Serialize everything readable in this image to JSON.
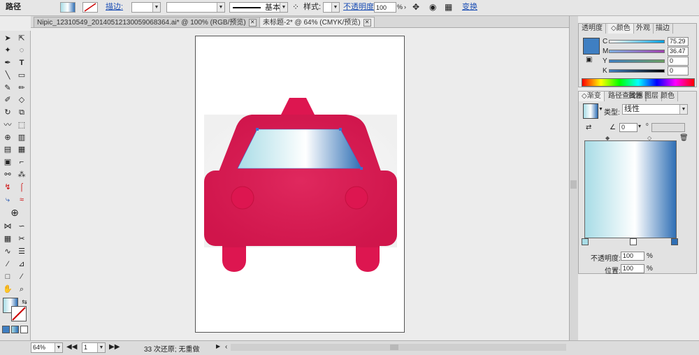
{
  "control_bar": {
    "path_label": "路径",
    "stroke_label": "描边:",
    "stroke_profile": "基本",
    "style_label": "样式:",
    "opacity_label": "不透明度:",
    "opacity_value": "100",
    "opacity_unit": "%",
    "transform_label": "变换"
  },
  "tabs": [
    {
      "label": "Nipic_12310549_20140512130059068364.ai* @ 100% (RGB/预览)"
    },
    {
      "label": "未标题-2* @ 64% (CMYK/预览)"
    }
  ],
  "toolbox": {
    "icons": [
      "selection-icon",
      "direct-selection-icon",
      "magic-wand-icon",
      "lasso-icon",
      "pen-icon",
      "type-icon",
      "line-icon",
      "rectangle-icon",
      "paintbrush-icon",
      "pencil-icon",
      "blob-brush-icon",
      "eraser-icon",
      "rotate-icon",
      "scale-icon",
      "warp-icon",
      "free-transform-icon",
      "shape-builder-icon",
      "live-paint-icon",
      "perspective-icon",
      "mesh-icon",
      "gradient-icon",
      "eyedropper-icon",
      "blend-icon",
      "symbol-sprayer-icon",
      "graph-icon",
      "artboard-icon",
      "slice-icon",
      "hand-icon",
      "zoom-icon"
    ]
  },
  "status": {
    "zoom": "64%",
    "page": "1",
    "message": "33 次还原; 无重做"
  },
  "color_panel": {
    "tabs": [
      "透明度",
      "颜色",
      "外观",
      "描边"
    ],
    "channels": [
      {
        "name": "C",
        "value": "75.29"
      },
      {
        "name": "M",
        "value": "36.47"
      },
      {
        "name": "Y",
        "value": "0"
      },
      {
        "name": "K",
        "value": "0"
      }
    ],
    "swatch_color": "#3f7fc2"
  },
  "gradient_panel": {
    "tabs": [
      "渐变",
      "路径查找器",
      "属性",
      "图层",
      "颜色"
    ],
    "type_label": "类型:",
    "type_value": "线性",
    "angle_value": "0",
    "opacity_label": "不透明度:",
    "opacity_value": "100",
    "position_label": "位置:",
    "position_value": "100",
    "percent": "%"
  },
  "colors": {
    "car_body": "#dd1650",
    "window_gradient": [
      "#a8dce6",
      "#ffffff",
      "#2f6fb5"
    ]
  }
}
